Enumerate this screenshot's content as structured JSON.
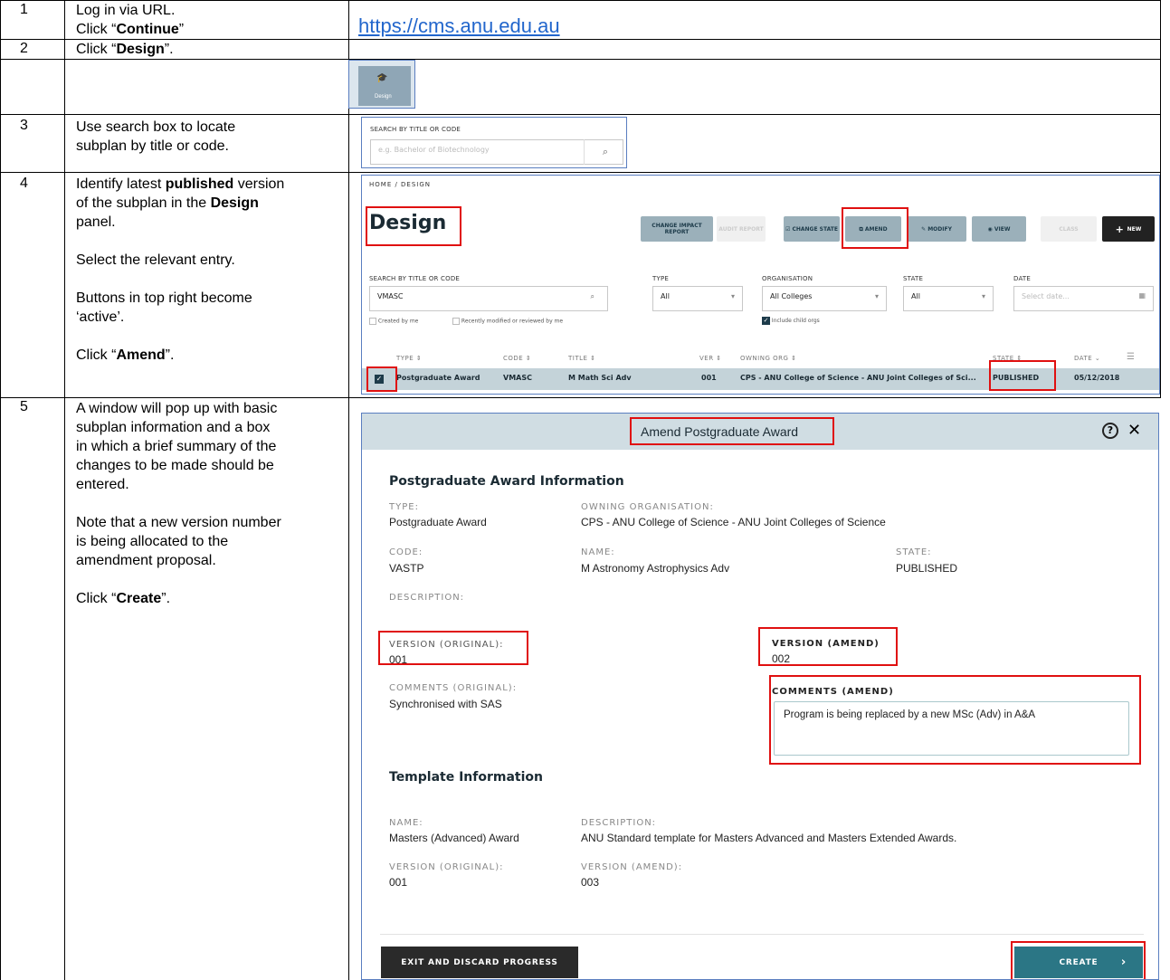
{
  "rows": [
    {
      "num": "1",
      "lines": [
        "Log in via URL.",
        "Click “",
        "Continue",
        "”"
      ],
      "url": "https://cms.anu.edu.au"
    },
    {
      "num": "2",
      "pre": "Click “",
      "bold": "Design",
      "post": "”."
    },
    {
      "num": "3",
      "lines": [
        "Use search box to locate",
        "subplan by title or code."
      ]
    },
    {
      "num": "4",
      "p1_pre": "Identify latest ",
      "p1_b1": "published",
      "p1_mid": " version",
      "p1_l2_pre": "of the subplan in the ",
      "p1_b2": "Design",
      "p1_l3": "panel.",
      "p2": "Select the relevant entry.",
      "p3_l1": "Buttons in top right become",
      "p3_l2": "‘active’.",
      "p4_pre": "Click “",
      "p4_b": "Amend",
      "p4_post": "”."
    },
    {
      "num": "5",
      "p1": [
        "A window will pop up with basic",
        "subplan information and a box",
        "in which a brief summary of the",
        "changes to be made should be",
        "entered."
      ],
      "p2": [
        "Note that a new version number",
        "is being allocated to the",
        "amendment proposal."
      ],
      "p3_pre": "Click “",
      "p3_b": "Create",
      "p3_post": "”."
    }
  ],
  "design_tile": {
    "label": "Design"
  },
  "search3": {
    "label": "SEARCH BY TITLE OR CODE",
    "placeholder": "e.g. Bachelor of Biotechnology"
  },
  "design_panel": {
    "breadcrumb": "HOME / DESIGN",
    "title": "Design",
    "buttons": {
      "change_impact": "CHANGE IMPACT REPORT",
      "audit": "AUDIT REPORT",
      "change_state": "CHANGE STATE",
      "amend": "AMEND",
      "modify": "MODIFY",
      "view": "VIEW",
      "clash": "CLASS",
      "new": "NEW"
    },
    "filters": {
      "search_label": "SEARCH BY TITLE OR CODE",
      "search_value": "VMASC",
      "type_label": "TYPE",
      "type_value": "All",
      "org_label": "ORGANISATION",
      "org_value": "All Colleges",
      "state_label": "STATE",
      "state_value": "All",
      "date_label": "DATE",
      "date_placeholder": "Select date...",
      "created_by_me": "Created by me",
      "recently": "Recently modified or reviewed by me",
      "include_child": "Include child orgs"
    },
    "columns": [
      "TYPE ⇕",
      "CODE ⇕",
      "TITLE ⇕",
      "VER ⇕",
      "OWNING ORG ⇕",
      "STATE ⇕",
      "DATE ⌄"
    ],
    "row": {
      "type": "Postgraduate Award",
      "code": "VMASC",
      "title": "M Math Sci Adv",
      "ver": "001",
      "org": "CPS - ANU College of Science - ANU Joint Colleges of Sci...",
      "state": "PUBLISHED",
      "date": "05/12/2018"
    }
  },
  "modal": {
    "title": "Amend Postgraduate Award",
    "help": "?",
    "close": "✕",
    "section1": "Postgraduate Award Information",
    "type_label": "TYPE:",
    "type_value": "Postgraduate Award",
    "owning_label": "OWNING ORGANISATION:",
    "owning_value": "CPS - ANU College of Science - ANU Joint Colleges of Science",
    "code_label": "CODE:",
    "code_value": "VASTP",
    "name_label": "NAME:",
    "name_value": "M Astronomy Astrophysics Adv",
    "state_label": "STATE:",
    "state_value": "PUBLISHED",
    "desc_label": "DESCRIPTION:",
    "ver_orig_label": "VERSION (ORIGINAL):",
    "ver_orig_value": "001",
    "ver_amend_label": "VERSION (AMEND)",
    "ver_amend_value": "002",
    "com_orig_label": "COMMENTS (ORIGINAL):",
    "com_orig_value": "Synchronised with SAS",
    "com_amend_label": "COMMENTS (AMEND)",
    "com_amend_value": "Program is being replaced by a new MSc (Adv) in A&A",
    "section2": "Template Information",
    "t_name_label": "NAME:",
    "t_name_value": "Masters (Advanced) Award",
    "t_desc_label": "DESCRIPTION:",
    "t_desc_value": "ANU Standard template for Masters Advanced and Masters Extended Awards.",
    "t_ver_orig_label": "VERSION (ORIGINAL):",
    "t_ver_orig_value": "001",
    "t_ver_amend_label": "VERSION (AMEND):",
    "t_ver_amend_value": "003",
    "exit_btn": "EXIT AND DISCARD PROGRESS",
    "create_btn": "CREATE"
  }
}
